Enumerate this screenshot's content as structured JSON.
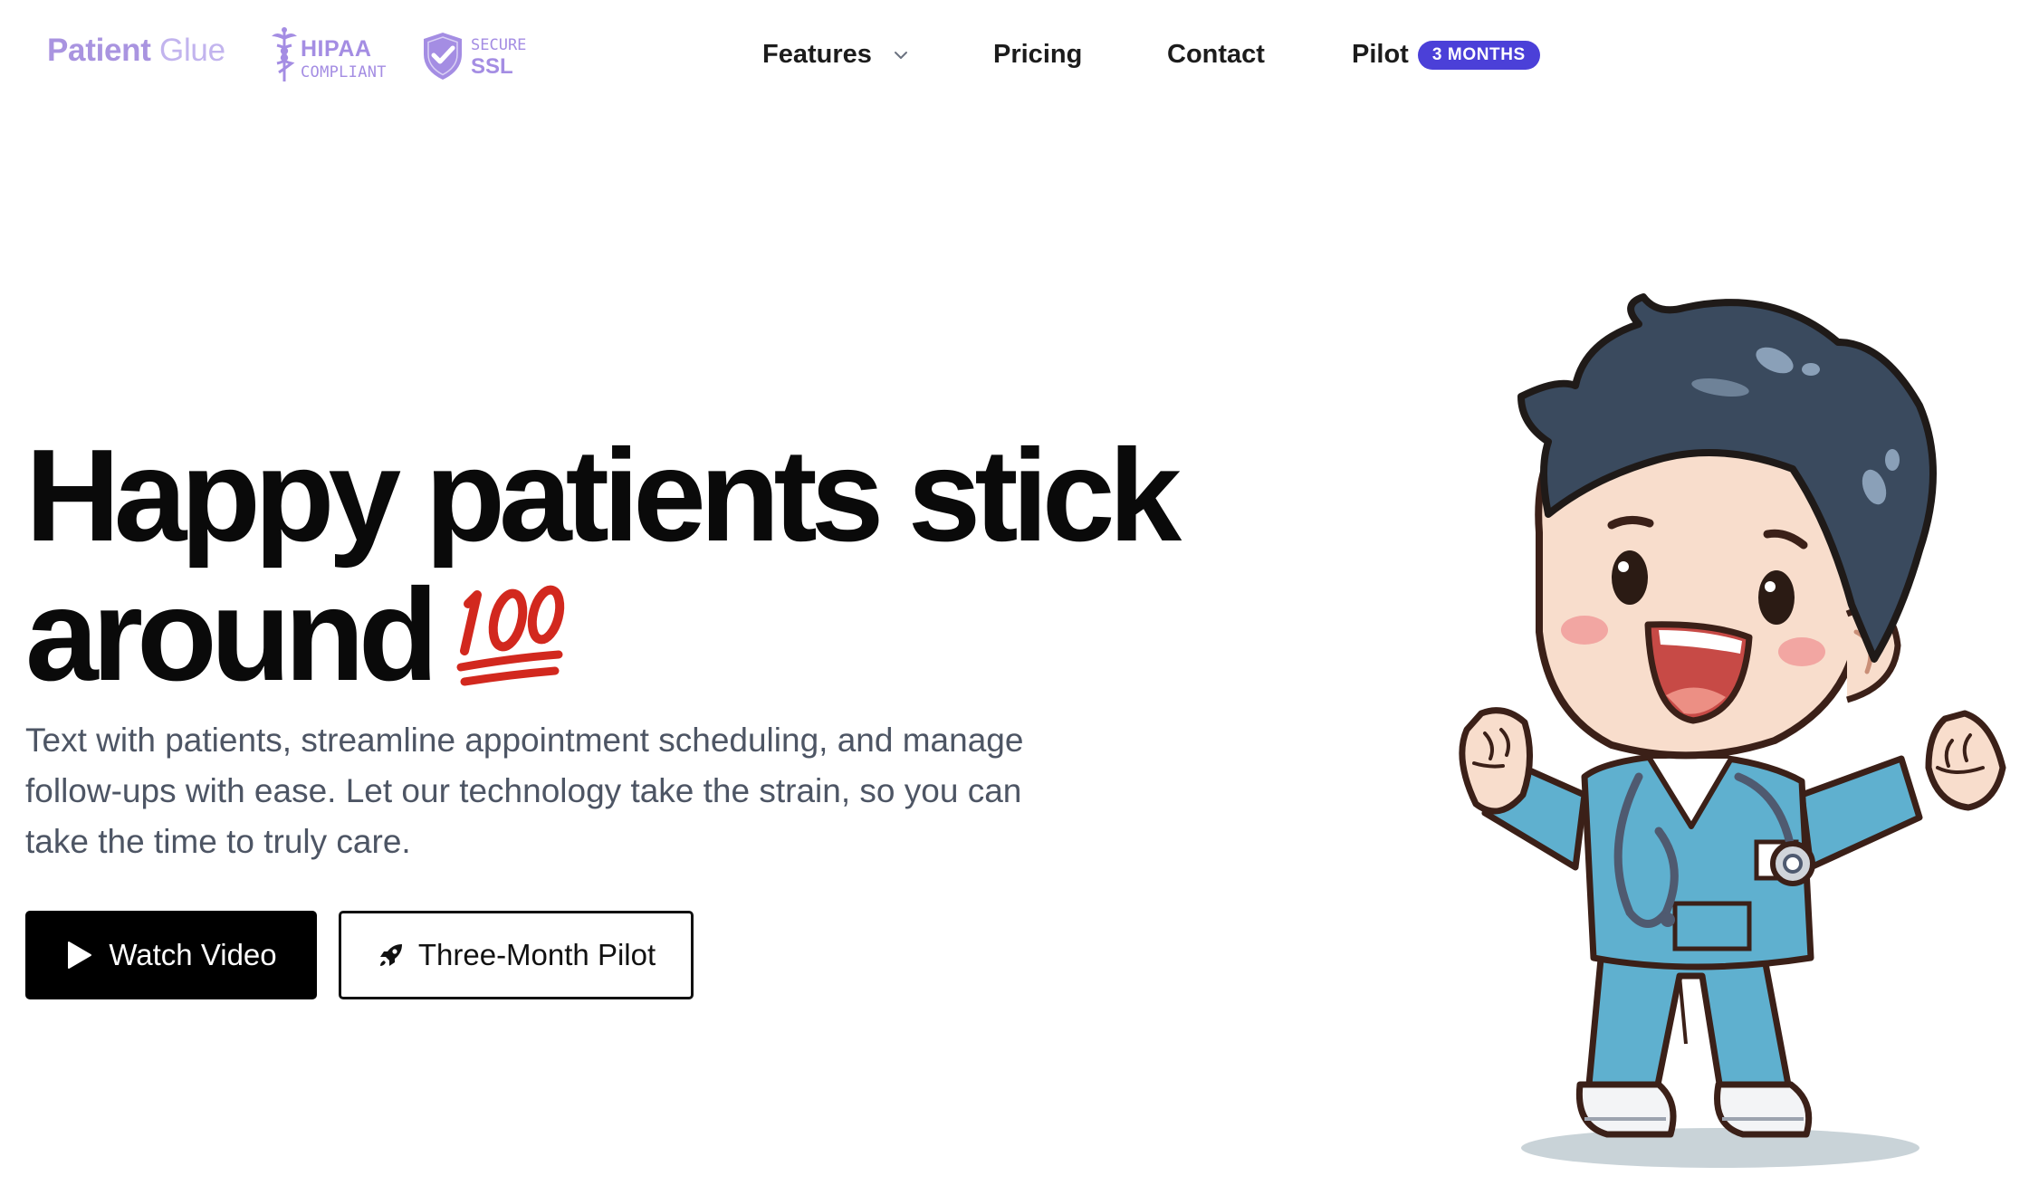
{
  "header": {
    "brand": {
      "word1": "Patient",
      "word2": "Glue"
    },
    "badges": {
      "hipaa": {
        "line1": "HIPAA",
        "line2": "COMPLIANT",
        "icon": "caduceus-icon"
      },
      "ssl": {
        "line1": "SECURE",
        "line2": "SSL",
        "icon": "shield-check-icon"
      }
    },
    "nav": {
      "features": "Features",
      "pricing": "Pricing",
      "contact": "Contact",
      "pilot": "Pilot",
      "pilot_badge": "3 MONTHS"
    }
  },
  "hero": {
    "title_line1": "Happy patients stick",
    "title_line2": "around",
    "title_emoji": "hundred-points-icon",
    "description": "Text with patients, streamline appointment scheduling, and manage follow-ups with ease. Let our technology take the strain, so you can take the time to truly care.",
    "buttons": {
      "watch_video": "Watch Video",
      "three_month_pilot": "Three-Month Pilot"
    },
    "illustration": "happy-nurse-mascot"
  },
  "colors": {
    "brand_purple": "#a994e0",
    "badge_purple": "#a48de3",
    "pilot_badge_bg": "#4b40d8",
    "text_dark": "#0a0a0a",
    "text_muted": "#4d5564",
    "hundred_red": "#d2281e",
    "scrubs": "#5fb0cf"
  }
}
